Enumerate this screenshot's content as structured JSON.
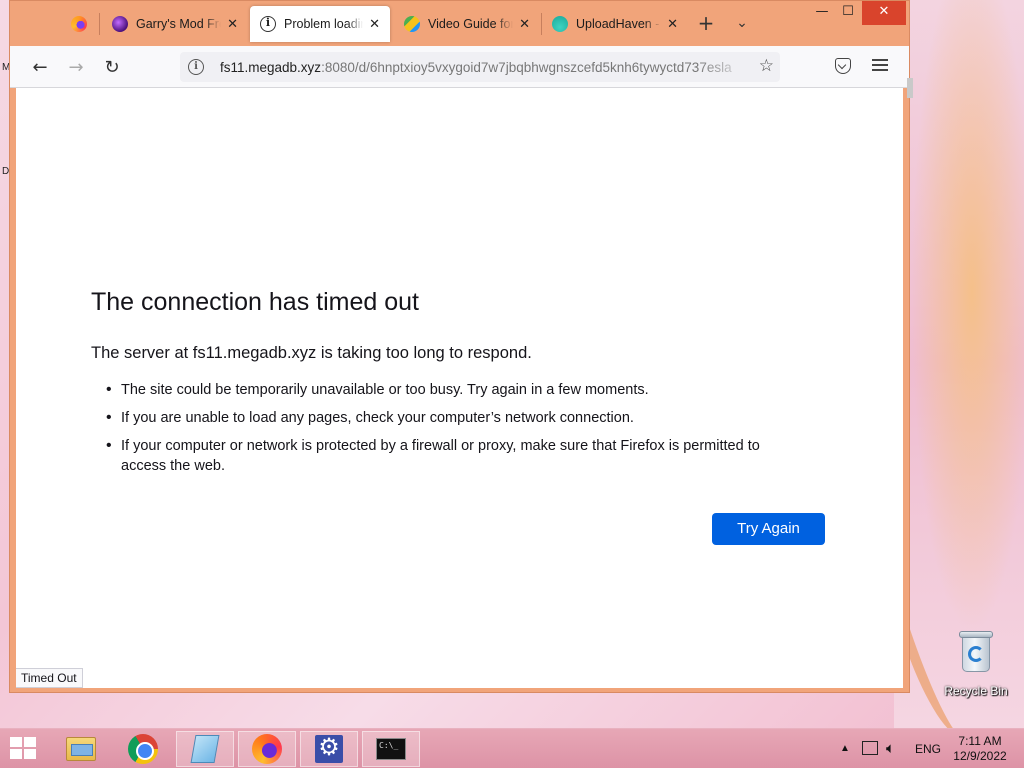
{
  "browser": {
    "tabs": [
      {
        "title": "",
        "favicon": "firefox-icon",
        "active": false
      },
      {
        "title": "Garry's Mod Free",
        "favicon": "gmod-icon",
        "active": false
      },
      {
        "title": "Problem loading",
        "favicon": "info-icon",
        "active": true
      },
      {
        "title": "Video Guide for I",
        "favicon": "cube-icon",
        "active": false
      },
      {
        "title": "UploadHaven - F",
        "favicon": "uploadhaven-icon",
        "active": false
      }
    ],
    "new_tab_label": "+",
    "list_tabs_label": "⌄",
    "window_controls": {
      "minimize": "—",
      "maximize": "☐",
      "close": "✕"
    },
    "url": {
      "host": "fs11.megadb.xyz",
      "rest": ":8080/d/6hnptxioy5vxygoid7w7jbqbhwgnszcefd5knh6tywyctd737esla"
    }
  },
  "page": {
    "title": "The connection has timed out",
    "description": "The server at fs11.megadb.xyz is taking too long to respond.",
    "tips": [
      "The site could be temporarily unavailable or too busy. Try again in a few moments.",
      "If you are unable to load any pages, check your computer’s network connection.",
      "If your computer or network is protected by a firewall or proxy, make sure that Firefox is permitted to access the web."
    ],
    "try_again_label": "Try Again",
    "status_text": "Timed Out"
  },
  "desktop": {
    "recycle_bin_label": "Recycle Bin",
    "left_edge_labels": [
      "M",
      "D"
    ]
  },
  "taskbar": {
    "apps": [
      "file-explorer-icon",
      "chrome-icon",
      "notepad-icon",
      "firefox-icon",
      "settings-icon",
      "command-prompt-icon"
    ],
    "cmd_text": "C:\\_",
    "language": "ENG",
    "time": "7:11 AM",
    "date": "12/9/2022"
  },
  "colors": {
    "window_frame": "#f1a47a",
    "primary_button": "#0061e0",
    "taskbar": "#dd93a6"
  }
}
